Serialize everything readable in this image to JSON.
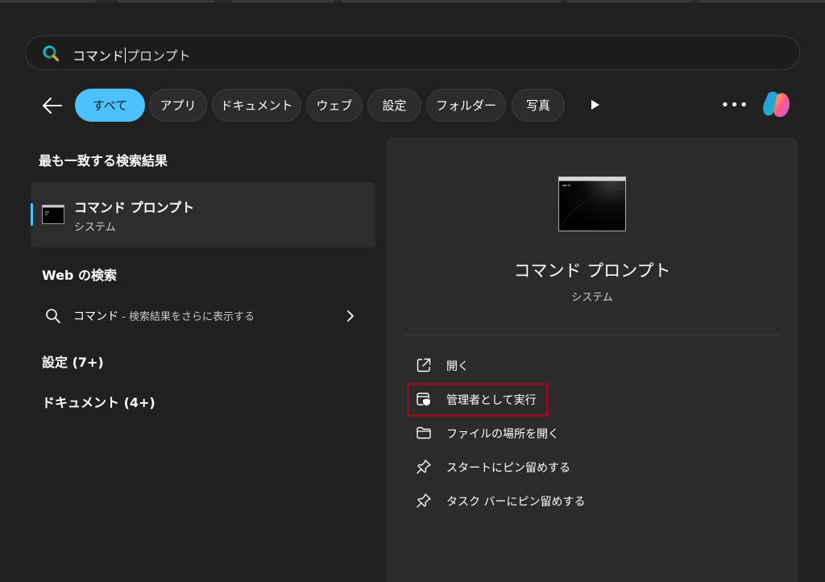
{
  "search": {
    "typed": "コマンド",
    "suggestion": "プロンプト"
  },
  "filters": [
    {
      "label": "すべて",
      "active": true
    },
    {
      "label": "アプリ"
    },
    {
      "label": "ドキュメント"
    },
    {
      "label": "ウェブ"
    },
    {
      "label": "設定"
    },
    {
      "label": "フォルダー"
    },
    {
      "label": "写真"
    }
  ],
  "more_label": "•••",
  "left": {
    "best_match_title": "最も一致する検索結果",
    "best_match": {
      "name": "コマンド プロンプト",
      "subtitle": "システム"
    },
    "web_title": "Web の検索",
    "web_result": {
      "query": "コマンド",
      "suffix": " - 検索結果をさらに表示する"
    },
    "settings_title": "設定 (7+)",
    "documents_title": "ドキュメント (4+)"
  },
  "preview": {
    "name": "コマンド プロンプト",
    "subtitle": "システム",
    "actions": [
      {
        "label": "開く",
        "icon": "open-external-icon"
      },
      {
        "label": "管理者として実行",
        "icon": "shield-window-icon"
      },
      {
        "label": "ファイルの場所を開く",
        "icon": "folder-icon"
      },
      {
        "label": "スタートにピン留めする",
        "icon": "pin-icon"
      },
      {
        "label": "タスク バーにピン留めする",
        "icon": "pin-icon"
      }
    ]
  },
  "colors": {
    "accent": "#4cc2ff",
    "highlight": "#8a0f1f",
    "background": "#202020",
    "panel": "#2b2b2b"
  }
}
